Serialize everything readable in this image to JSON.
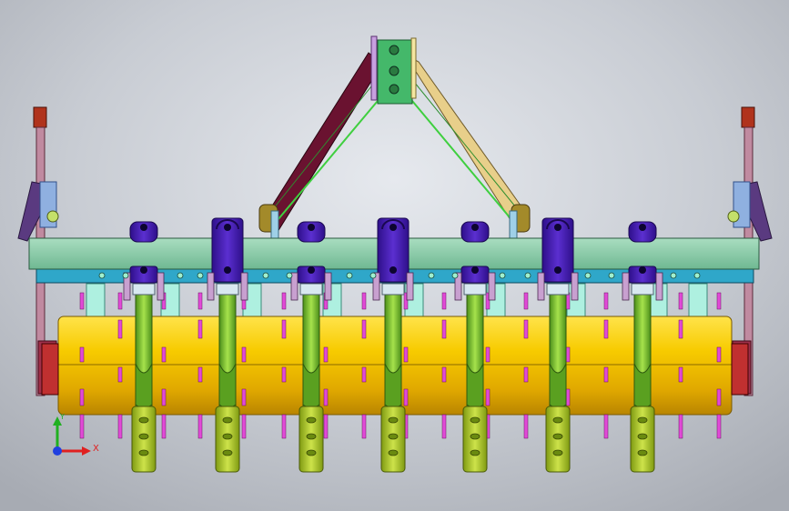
{
  "viewport": {
    "background_top": "#e6e9ee",
    "background_bottom": "#a7abb3"
  },
  "model": {
    "subject": "rotary-cultivator-seeder-assembly",
    "tine_count": 7,
    "roller_blade_count": 12,
    "clamp_count": 7,
    "colors": {
      "frame_beam": "#8fcfae",
      "sub_beam": "#2fa7c9",
      "roller": "#f2c400",
      "roller_blades": "#e14ad7",
      "tine": "#7bc431",
      "tine_foot": "#b4d02a",
      "clamp": "#4a1fb3",
      "hitch_left": "#6a1230",
      "hitch_right": "#e8cf8a",
      "hitch_plate": "#44b86a",
      "side_knob": "#b0331c",
      "spring_brace": "#3fcf3f"
    }
  },
  "triad": {
    "icon": "coordinate-axes-icon",
    "x_label": "X",
    "y_label": "Y",
    "x_color": "#e02020",
    "y_color": "#20b020",
    "z_color": "#2040e0"
  }
}
